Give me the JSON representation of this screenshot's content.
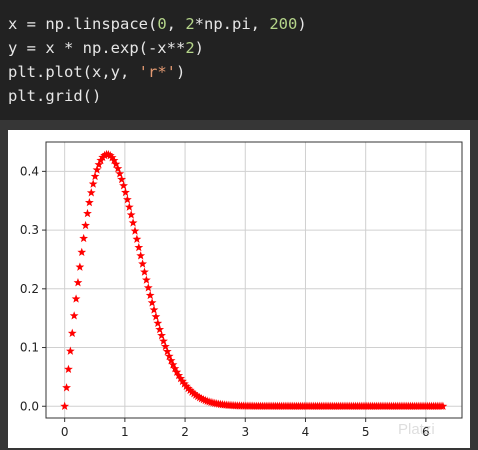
{
  "code_lines": [
    [
      {
        "t": "x = np.linspace(",
        "c": ""
      },
      {
        "t": "0",
        "c": "num"
      },
      {
        "t": ", ",
        "c": ""
      },
      {
        "t": "2",
        "c": "num"
      },
      {
        "t": "*np.pi, ",
        "c": ""
      },
      {
        "t": "200",
        "c": "num"
      },
      {
        "t": ")",
        "c": ""
      }
    ],
    [
      {
        "t": "y = x * np.exp(-x**",
        "c": ""
      },
      {
        "t": "2",
        "c": "num"
      },
      {
        "t": ")",
        "c": ""
      }
    ],
    [
      {
        "t": "plt.plot(x,y, ",
        "c": ""
      },
      {
        "t": "'r*'",
        "c": "str"
      },
      {
        "t": ")",
        "c": ""
      }
    ],
    [
      {
        "t": "plt.grid()",
        "c": ""
      }
    ]
  ],
  "watermark": "Platzi",
  "colors": {
    "marker": "#ff0000",
    "grid": "#d0d0d0",
    "axes": "#333333",
    "code_bg": "#222222",
    "number": "#b5d58a",
    "string": "#e39a72"
  },
  "chart_data": {
    "type": "scatter",
    "function": "y = x * exp(-x^2)",
    "x_range": [
      0,
      6.283185307179586
    ],
    "num_points": 200,
    "marker": "red star",
    "xlim": [
      -0.31,
      6.6
    ],
    "ylim": [
      -0.02,
      0.45
    ],
    "xticks": [
      0,
      1,
      2,
      3,
      4,
      5,
      6
    ],
    "yticks": [
      0.0,
      0.1,
      0.2,
      0.3,
      0.4
    ],
    "xtick_labels": [
      "0",
      "1",
      "2",
      "3",
      "4",
      "5",
      "6"
    ],
    "ytick_labels": [
      "0.0",
      "0.1",
      "0.2",
      "0.3",
      "0.4"
    ],
    "grid": true,
    "title": "",
    "xlabel": "",
    "ylabel": ""
  }
}
